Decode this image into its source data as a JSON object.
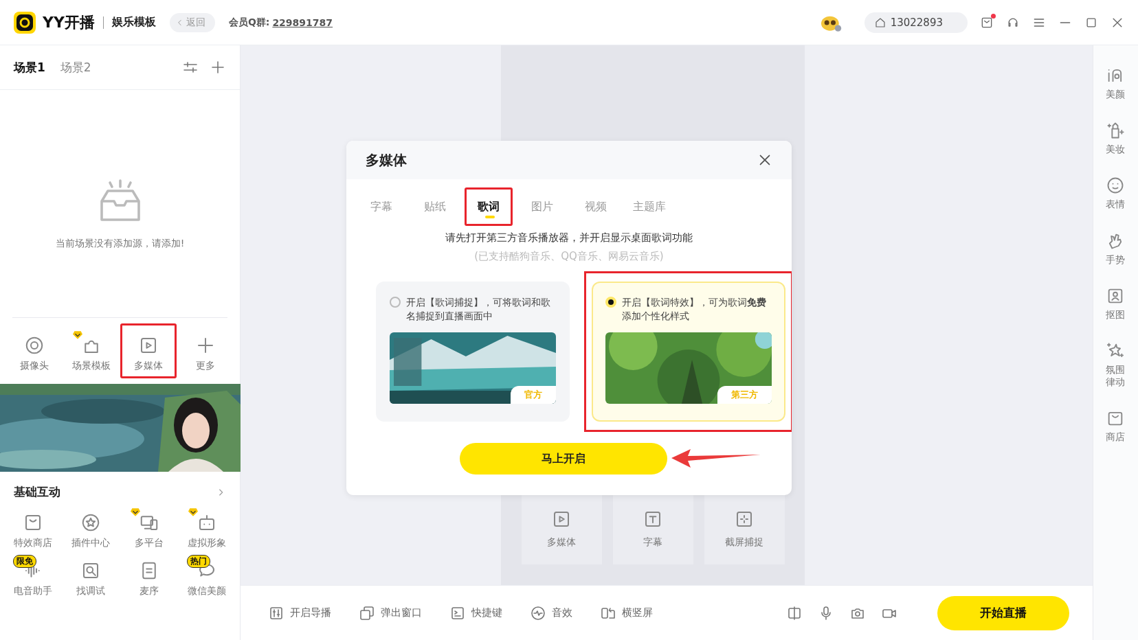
{
  "app": {
    "logo": "YY开播",
    "mode": "娱乐模板",
    "back": "返回",
    "group_label": "会员Q群:",
    "group_number": "229891787",
    "user_id": "13022893",
    "notification": true
  },
  "scenes": {
    "tabs": [
      {
        "label": "场景1",
        "selected": true
      },
      {
        "label": "场景2",
        "selected": false
      }
    ],
    "empty_message": "当前场景没有添加源，请添加!"
  },
  "tools": [
    {
      "label": "摄像头",
      "kind": "camera",
      "premium": false,
      "highlighted": false
    },
    {
      "label": "场景模板",
      "kind": "puzzle",
      "premium": true,
      "highlighted": false
    },
    {
      "label": "多媒体",
      "kind": "media",
      "premium": false,
      "highlighted": true
    },
    {
      "label": "更多",
      "kind": "plus",
      "premium": false,
      "highlighted": false
    }
  ],
  "basic": {
    "title": "基础互动",
    "items": [
      {
        "label": "特效商店",
        "kind": "shop",
        "premium": false
      },
      {
        "label": "插件中心",
        "kind": "plugin",
        "premium": false
      },
      {
        "label": "多平台",
        "kind": "multi",
        "premium": true
      },
      {
        "label": "虚拟形象",
        "kind": "avatar",
        "premium": true
      },
      {
        "label": "电音助手",
        "kind": "audio",
        "premium": false,
        "badge": "限免"
      },
      {
        "label": "找调试",
        "kind": "debug",
        "premium": false
      },
      {
        "label": "麦序",
        "kind": "queue",
        "premium": false
      },
      {
        "label": "微信美颜",
        "kind": "chat",
        "premium": false,
        "badge": "热门"
      }
    ]
  },
  "stage_tiles": [
    {
      "label": "多媒体",
      "kind": "media"
    },
    {
      "label": "字幕",
      "kind": "text"
    },
    {
      "label": "截屏捕捉",
      "kind": "capture"
    }
  ],
  "dialog": {
    "title": "多媒体",
    "tabs": [
      {
        "label": "字幕",
        "selected": false,
        "highlighted": false
      },
      {
        "label": "贴纸",
        "selected": false,
        "highlighted": false
      },
      {
        "label": "歌词",
        "selected": true,
        "highlighted": true
      },
      {
        "label": "图片",
        "selected": false,
        "highlighted": false
      },
      {
        "label": "视频",
        "selected": false,
        "highlighted": false
      },
      {
        "label": "主题库",
        "selected": false,
        "highlighted": false
      }
    ],
    "instruction": "请先打开第三方音乐播放器，并开启显示桌面歌词功能",
    "supported": "(已支持酷狗音乐、QQ音乐、网易云音乐)",
    "options": [
      {
        "text": "开启【歌词捕捉】，可将歌词和歌名捕捉到直播画面中",
        "tag": "官方",
        "kind": "lake",
        "selected": false,
        "highlighted": false
      },
      {
        "text": "开启【歌词特效】，可为歌词**免费**添加个性化样式",
        "tag": "第三方",
        "kind": "forest",
        "selected": true,
        "highlighted": true
      }
    ],
    "button": "马上开启"
  },
  "bottom_bar": {
    "tools": [
      {
        "label": "开启导播",
        "kind": "director"
      },
      {
        "label": "弹出窗口",
        "kind": "popup"
      },
      {
        "label": "快捷键",
        "kind": "hotkey"
      },
      {
        "label": "音效",
        "kind": "sound"
      },
      {
        "label": "横竖屏",
        "kind": "rotate"
      }
    ],
    "start_button": "开始直播"
  },
  "right_sidebar": [
    {
      "label": "美颜",
      "kind": "beauty"
    },
    {
      "label": "美妆",
      "kind": "makeup"
    },
    {
      "label": "表情",
      "kind": "smile"
    },
    {
      "label": "手势",
      "kind": "hand"
    },
    {
      "label": "抠图",
      "kind": "cutout"
    },
    {
      "label": "氛围律动",
      "kind": "sparkle"
    },
    {
      "label": "商店",
      "kind": "bag"
    }
  ]
}
